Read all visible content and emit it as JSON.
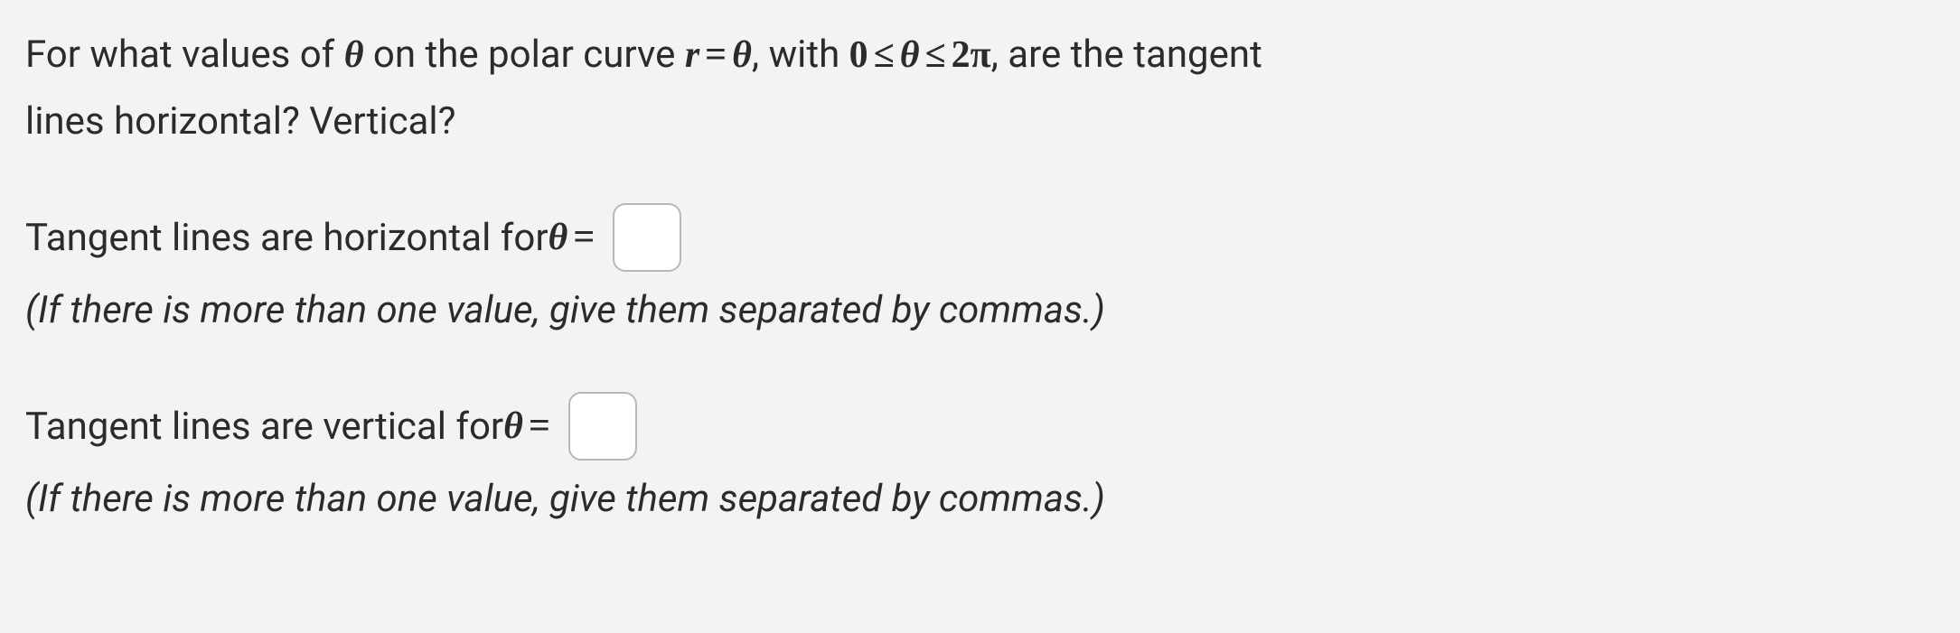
{
  "question": {
    "part1": "For what values of ",
    "theta": "θ",
    "part2": " on the polar curve ",
    "r": "r",
    "eq": "=",
    "part3": ", with ",
    "zero": "0",
    "le": "≤",
    "twopi": "2π",
    "part4": ", are the tangent",
    "line2": "lines horizontal? Vertical?"
  },
  "horizontal": {
    "label_pre": "Tangent lines are horizontal for ",
    "theta": "θ",
    "eq": "=",
    "value": "",
    "hint": "(If there is more than one value, give them separated by commas.)"
  },
  "vertical": {
    "label_pre": "Tangent lines are vertical for ",
    "theta": "θ",
    "eq": "=",
    "value": "",
    "hint": "(If there is more than one value, give them separated by commas.)"
  }
}
